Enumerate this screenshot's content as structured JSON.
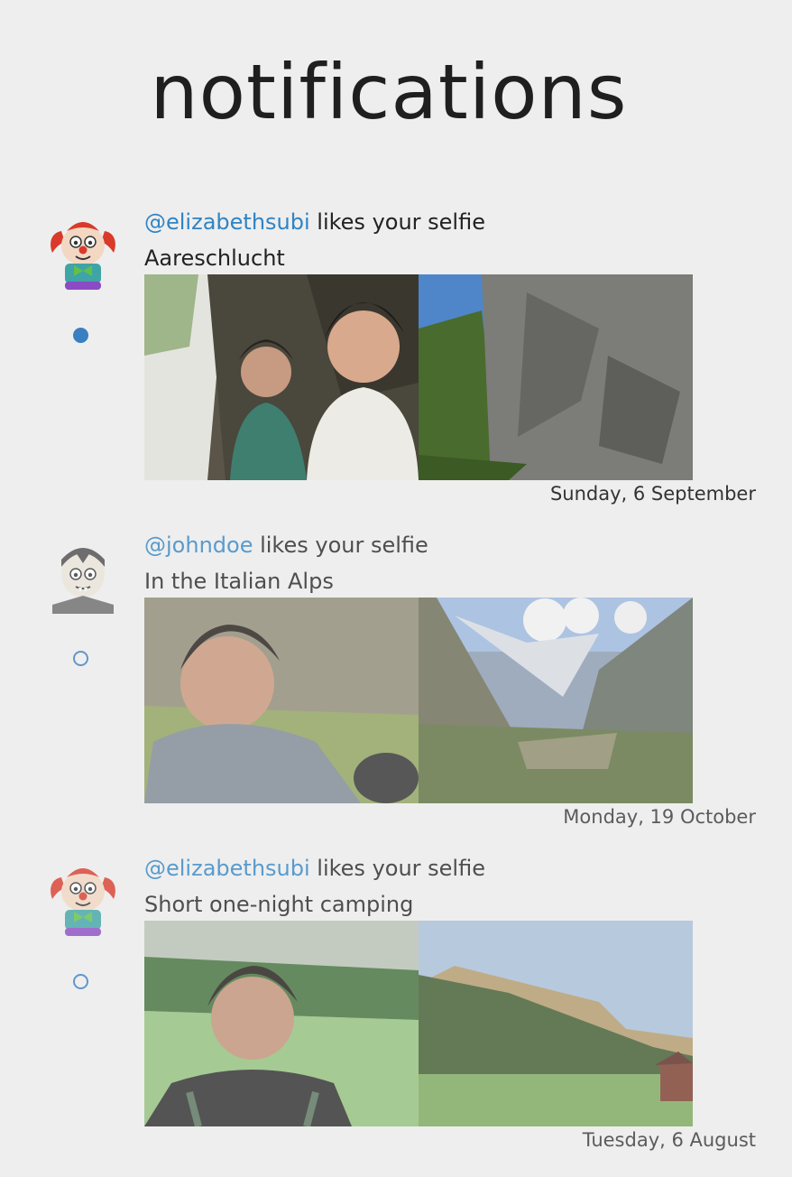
{
  "header": {
    "title": "notifications"
  },
  "notifications": [
    {
      "user": "@elizabethsubi",
      "action": " likes your selfie",
      "caption": "Aareschlucht",
      "date": "Sunday, 6 September",
      "unread": true,
      "avatar_icon": "clown-avatar-icon",
      "photos": [
        "selfie-in-gorge-photo",
        "rock-wall-photo"
      ]
    },
    {
      "user": "@johndoe",
      "action": " likes your selfie",
      "caption": "In the Italian Alps",
      "date": "Monday, 19 October",
      "unread": false,
      "avatar_icon": "vampire-avatar-icon",
      "photos": [
        "selfie-in-valley-photo",
        "alpine-valley-photo"
      ]
    },
    {
      "user": "@elizabethsubi",
      "action": " likes your selfie",
      "caption": "Short one-night camping",
      "date": "Tuesday, 6 August",
      "unread": false,
      "avatar_icon": "clown-avatar-icon",
      "photos": [
        "selfie-in-meadow-photo",
        "mountain-meadow-photo"
      ]
    }
  ],
  "colors": {
    "background": "#eeeeee",
    "username": "#2f84c4",
    "dot": "#3a7fc1"
  }
}
